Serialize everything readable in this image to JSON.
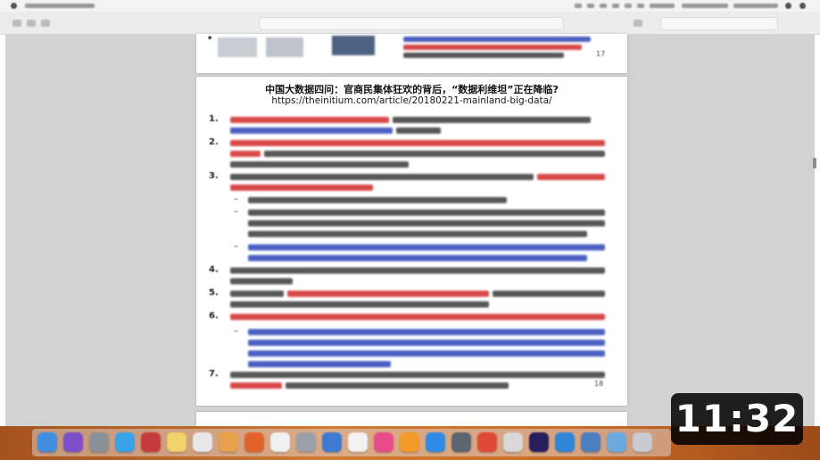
{
  "document": {
    "prev_bullet": "•",
    "prev_page_number": "17",
    "title": "中国大数据四问：官商民集体狂欢的背后，“数据利维坦”正在降临?",
    "url": "https://theinitium.com/article/20180221-mainland-big-data/",
    "bullets": [
      "1.",
      "2.",
      "3.",
      "4.",
      "5.",
      "6.",
      "7."
    ],
    "sub_bullet": "–",
    "page_number": "18"
  },
  "video": {
    "duration": "11:32"
  },
  "colors": {
    "text_red": "#d22a2a",
    "text_blue": "#2c45b8",
    "text_black": "#3a3a3a",
    "badge_bg": "#000000"
  },
  "dock": {
    "icons": [
      {
        "name": "finder-icon",
        "color": "#3f8ee0"
      },
      {
        "name": "siri-icon",
        "color": "#7a4fc9"
      },
      {
        "name": "launchpad-icon",
        "color": "#8a8f98"
      },
      {
        "name": "safari-icon",
        "color": "#3aa0e8"
      },
      {
        "name": "photo-booth-icon",
        "color": "#c43a3a"
      },
      {
        "name": "notes-icon",
        "color": "#f2d26a"
      },
      {
        "name": "preview-icon",
        "color": "#e8e8e8"
      },
      {
        "name": "photos-icon",
        "color": "#e9a04a"
      },
      {
        "name": "firefox-icon",
        "color": "#e2632a"
      },
      {
        "name": "messages-icon",
        "color": "#f0f0f0"
      },
      {
        "name": "system-preferences-icon",
        "color": "#9aa0a8"
      },
      {
        "name": "keynote-icon",
        "color": "#3b7bd4"
      },
      {
        "name": "app-icon",
        "color": "#f2f2f2"
      },
      {
        "name": "itunes-icon",
        "color": "#e94b8a"
      },
      {
        "name": "ibooks-icon",
        "color": "#f29b2a"
      },
      {
        "name": "app-store-icon",
        "color": "#2e8be6"
      },
      {
        "name": "camera-icon",
        "color": "#5c6470"
      },
      {
        "name": "chrome-icon",
        "color": "#e0493a"
      },
      {
        "name": "grab-icon",
        "color": "#d8d8d8"
      },
      {
        "name": "after-effects-icon",
        "color": "#2a1f5e"
      },
      {
        "name": "skype-icon",
        "color": "#2f86d8"
      },
      {
        "name": "screen-icon",
        "color": "#4a7fc0"
      },
      {
        "name": "folder-icon",
        "color": "#6aa8e0"
      },
      {
        "name": "trash-icon",
        "color": "#c8ccd2"
      }
    ]
  }
}
